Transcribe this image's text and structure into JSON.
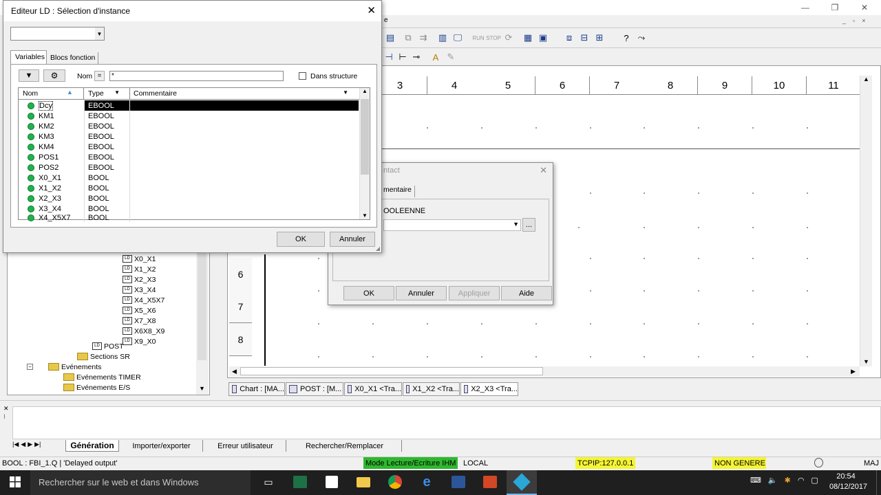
{
  "main_window": {
    "title_partial": "e",
    "controls": {
      "minimize": "—",
      "restore": "❐",
      "close": "✕"
    }
  },
  "ld_editor": {
    "columns": [
      "3",
      "4",
      "5",
      "6",
      "7",
      "8",
      "9",
      "10",
      "11"
    ],
    "rows": [
      "6",
      "7",
      "8"
    ]
  },
  "tree": {
    "items": [
      {
        "label": "X0_X1",
        "type": "ld"
      },
      {
        "label": "X1_X2",
        "type": "ld"
      },
      {
        "label": "X2_X3",
        "type": "ld"
      },
      {
        "label": "X3_X4",
        "type": "ld"
      },
      {
        "label": "X4_X5X7",
        "type": "ld"
      },
      {
        "label": "X5_X6",
        "type": "ld"
      },
      {
        "label": "X7_X8",
        "type": "ld"
      },
      {
        "label": "X6X8_X9",
        "type": "ld"
      },
      {
        "label": "X9_X0",
        "type": "ld"
      },
      {
        "label": "POST",
        "type": "ld"
      },
      {
        "label": "Sections SR",
        "type": "folder"
      },
      {
        "label": "Evénements",
        "type": "folder"
      },
      {
        "label": "Evénements TIMER",
        "type": "folder"
      },
      {
        "label": "Evénements E/S",
        "type": "folder"
      }
    ]
  },
  "editor_tabs": [
    {
      "label": "Chart : [MA..."
    },
    {
      "label": "POST : [M..."
    },
    {
      "label": "X0_X1 <Tra..."
    },
    {
      "label": "X1_X2 <Tra..."
    },
    {
      "label": "X2_X3 <Tra..."
    }
  ],
  "contact_dialog": {
    "title_partial": "ntact",
    "tab_partial": "mentaire",
    "group_label_partial": "OOLEENNE",
    "browse_label": "...",
    "buttons": {
      "ok": "OK",
      "cancel": "Annuler",
      "apply": "Appliquer",
      "help": "Aide"
    }
  },
  "instance_dialog": {
    "title": "Editeur LD : Sélection d'instance",
    "close": "✕",
    "tabs": [
      "Variables",
      "Blocs fonction"
    ],
    "filter_label": "Nom",
    "filter_op": "=",
    "filter_value": "*",
    "checkbox_label": "Dans structure",
    "grid_headers": {
      "name": "Nom",
      "type": "Type",
      "comment": "Commentaire"
    },
    "rows": [
      {
        "name": "Dcy",
        "type": "EBOOL",
        "comment": ""
      },
      {
        "name": "KM1",
        "type": "EBOOL",
        "comment": ""
      },
      {
        "name": "KM2",
        "type": "EBOOL",
        "comment": ""
      },
      {
        "name": "KM3",
        "type": "EBOOL",
        "comment": ""
      },
      {
        "name": "KM4",
        "type": "EBOOL",
        "comment": ""
      },
      {
        "name": "POS1",
        "type": "EBOOL",
        "comment": ""
      },
      {
        "name": "POS2",
        "type": "EBOOL",
        "comment": ""
      },
      {
        "name": "X0_X1",
        "type": "BOOL",
        "comment": ""
      },
      {
        "name": "X1_X2",
        "type": "BOOL",
        "comment": ""
      },
      {
        "name": "X2_X3",
        "type": "BOOL",
        "comment": ""
      },
      {
        "name": "X3_X4",
        "type": "BOOL",
        "comment": ""
      },
      {
        "name": "X4_X5X7",
        "type": "BOOL",
        "comment": ""
      }
    ],
    "buttons": {
      "ok": "OK",
      "cancel": "Annuler"
    }
  },
  "output_tabs": [
    "Génération",
    "Importer/exporter",
    "Erreur utilisateur",
    "Rechercher/Remplacer"
  ],
  "status_bar": {
    "info": "BOOL : FBI_1.Q | 'Delayed output'",
    "mode": "Mode Lecture/Ecriture IHM",
    "local": "LOCAL",
    "address": "TCPIP:127.0.0.1",
    "gen": "NON GENERE",
    "caps": "MAJ"
  },
  "colors": {
    "mode_bg": "#2fb82f",
    "address_bg": "#f5f535",
    "gen_bg": "#f5f535",
    "taskbar": "#1f1f1f"
  },
  "taskbar": {
    "search_placeholder": "Rechercher sur le web et dans Windows",
    "time": "20:54",
    "date": "08/12/2017"
  }
}
